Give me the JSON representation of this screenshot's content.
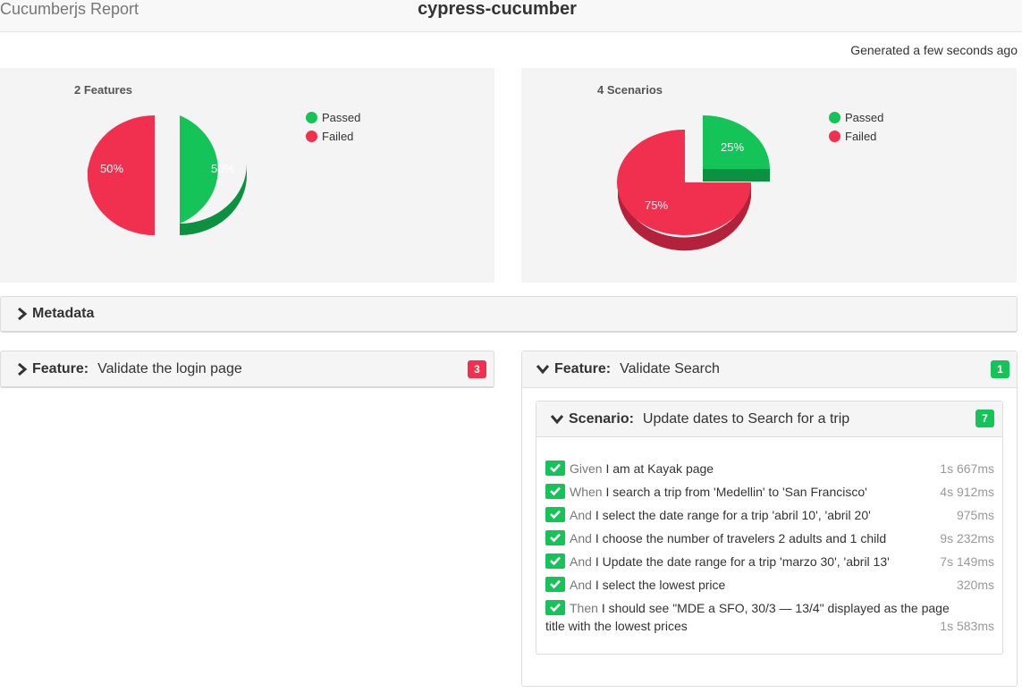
{
  "header": {
    "brand": "Cucumberjs Report",
    "project": "cypress-cucumber",
    "generated": "Generated a few seconds ago"
  },
  "colors": {
    "passed": "#14c458",
    "failed": "#f0304e"
  },
  "charts": {
    "features": {
      "title": "2 Features",
      "legend": [
        "Passed",
        "Failed"
      ],
      "slices": [
        {
          "name": "Passed",
          "value": 50,
          "label": "50%"
        },
        {
          "name": "Failed",
          "value": 50,
          "label": "50%"
        }
      ]
    },
    "scenarios": {
      "title": "4 Scenarios",
      "legend": [
        "Passed",
        "Failed"
      ],
      "slices": [
        {
          "name": "Passed",
          "value": 25,
          "label": "25%"
        },
        {
          "name": "Failed",
          "value": 75,
          "label": "75%"
        }
      ]
    }
  },
  "chart_data": [
    {
      "type": "pie",
      "title": "2 Features",
      "categories": [
        "Passed",
        "Failed"
      ],
      "values": [
        50,
        50
      ],
      "legend": "right"
    },
    {
      "type": "pie",
      "title": "4 Scenarios",
      "categories": [
        "Passed",
        "Failed"
      ],
      "values": [
        25,
        75
      ],
      "legend": "right"
    }
  ],
  "metadata": {
    "label": "Metadata",
    "icon": "chevron-right-icon"
  },
  "features": [
    {
      "keyword": "Feature:",
      "name": "Validate the login page",
      "badge": "3",
      "status": "failed",
      "icon": "chevron-right-icon"
    },
    {
      "keyword": "Feature:",
      "name": "Validate Search",
      "badge": "1",
      "status": "passed",
      "icon": "chevron-down-icon",
      "scenario": {
        "keyword": "Scenario:",
        "name": "Update dates to Search for a trip",
        "badge": "7",
        "steps": [
          {
            "keyword": "Given",
            "text": "I am at Kayak page",
            "duration": "1s 667ms"
          },
          {
            "keyword": "When",
            "text": "I search a trip from 'Medellin' to 'San Francisco'",
            "duration": "4s 912ms"
          },
          {
            "keyword": "And",
            "text": "I select the date range for a trip 'abril 10', 'abril 20'",
            "duration": "975ms"
          },
          {
            "keyword": "And",
            "text": "I choose the number of travelers 2 adults and 1 child",
            "duration": "9s 232ms"
          },
          {
            "keyword": "And",
            "text": "I Update the date range for a trip 'marzo 30', 'abril 13'",
            "duration": "7s 149ms"
          },
          {
            "keyword": "And",
            "text": "I select the lowest price",
            "duration": "320ms"
          },
          {
            "keyword": "Then",
            "text": "I should see \"MDE a SFO, 30/3 — 13/4\" displayed as the page title with the lowest prices",
            "duration": "1s 583ms"
          }
        ]
      }
    }
  ]
}
